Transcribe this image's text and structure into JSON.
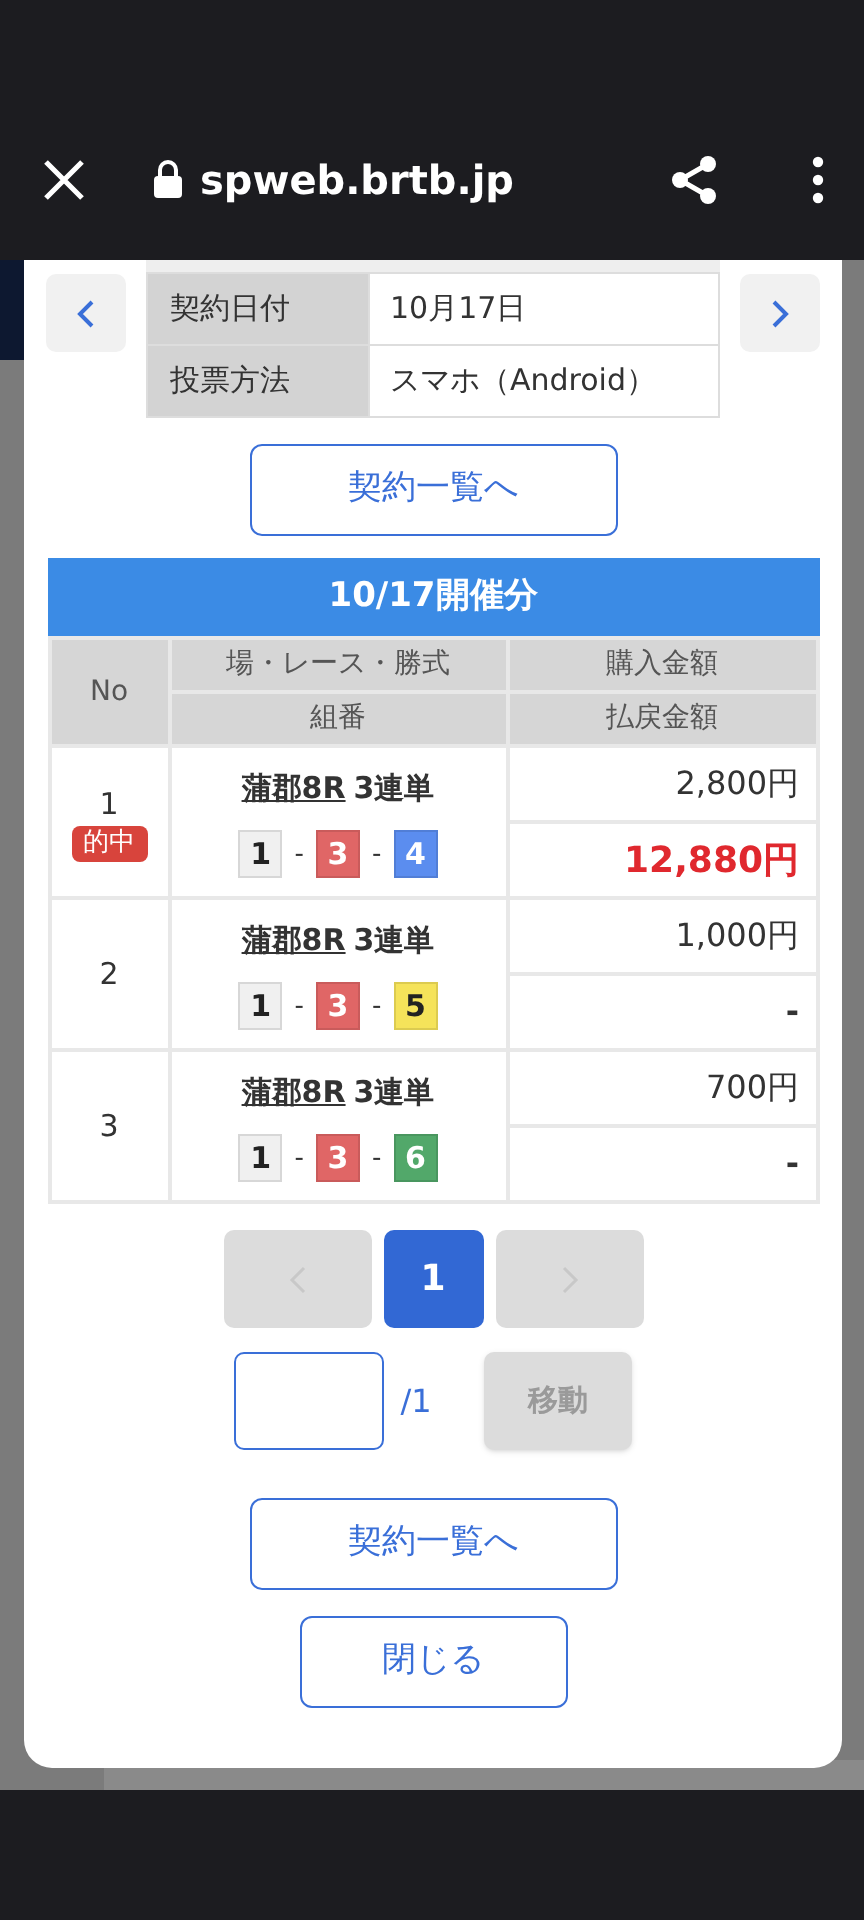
{
  "browser": {
    "url": "spweb.brtb.jp"
  },
  "info": [
    {
      "label": "契約日付",
      "value": "10月17日"
    },
    {
      "label": "投票方法",
      "value": "スマホ（Android）"
    }
  ],
  "top_button": "契約一覧へ",
  "table": {
    "title": "10/17開催分",
    "headers": {
      "no": "No",
      "race": "場・レース・勝式",
      "combo": "組番",
      "bet": "購入金額",
      "payout": "払戻金額"
    },
    "rows": [
      {
        "no": "1",
        "hit": true,
        "badge": "的中",
        "race": "蒲郡8R",
        "type": "3連単",
        "combo": [
          {
            "number": "1",
            "color": "#f0f0f0"
          },
          {
            "number": "3",
            "color": "#e06666"
          },
          {
            "number": "4",
            "color": "#5b8def"
          }
        ],
        "sep": "-",
        "bet": "2,800円",
        "payout": "12,880円"
      },
      {
        "no": "2",
        "hit": false,
        "race": "蒲郡8R",
        "type": "3連単",
        "combo": [
          {
            "number": "1",
            "color": "#f0f0f0"
          },
          {
            "number": "3",
            "color": "#e06666"
          },
          {
            "number": "5",
            "color": "#f5e35a"
          }
        ],
        "sep": "-",
        "bet": "1,000円",
        "payout": "-"
      },
      {
        "no": "3",
        "hit": false,
        "race": "蒲郡8R",
        "type": "3連単",
        "combo": [
          {
            "number": "1",
            "color": "#f0f0f0"
          },
          {
            "number": "3",
            "color": "#e06666"
          },
          {
            "number": "6",
            "color": "#52a86a"
          }
        ],
        "sep": "-",
        "bet": "700円",
        "payout": "-"
      }
    ]
  },
  "pager": {
    "prev_disabled": true,
    "next_disabled": true,
    "pages": [
      {
        "label": "1",
        "selected": true
      }
    ]
  },
  "jump": {
    "total": "/1",
    "button": "移動",
    "disabled": true
  },
  "buttons": [
    "契約一覧へ",
    "閉じる"
  ]
}
